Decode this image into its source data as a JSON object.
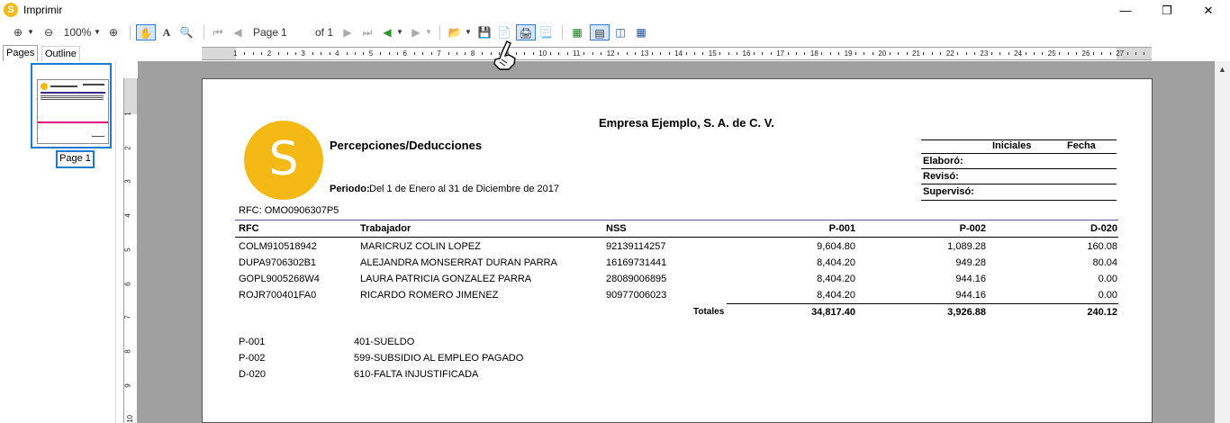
{
  "window": {
    "title": "Imprimir",
    "app_icon_letter": "S",
    "minimize_icon": "minimize-icon",
    "maximize_icon": "restore-icon",
    "close_icon": "close-icon"
  },
  "toolbar": {
    "zoom_value": "100%",
    "page_label": "Page",
    "page_value": "1",
    "of_label": "of 1"
  },
  "tabs": {
    "pages": "Pages",
    "outline": "Outline"
  },
  "ruler": {
    "h_numbers": [
      "1",
      "2",
      "3",
      "4",
      "5",
      "6",
      "7",
      "8",
      "9",
      "10",
      "11",
      "12",
      "13",
      "14",
      "15",
      "16",
      "17",
      "18",
      "19",
      "20",
      "21",
      "22",
      "23",
      "24",
      "25",
      "26",
      "27"
    ],
    "v_numbers": [
      "1",
      "2",
      "3",
      "4",
      "5",
      "6",
      "7",
      "8",
      "9",
      "10"
    ]
  },
  "thumbnail": {
    "label": "Page 1"
  },
  "report": {
    "logo_letter": "S",
    "company": "Empresa Ejemplo, S. A. de C. V.",
    "title": "Percepciones/Deducciones",
    "period_label": "Periodo:",
    "period_value": "Del 1 de Enero al 31 de Diciembre de 2017",
    "rfc_line": "RFC: OMO0906307P5",
    "sign_box": {
      "col1": "Iniciales",
      "col2": "Fecha",
      "rows": [
        "Elaboró:",
        "Revisó:",
        "Supervisó:"
      ]
    },
    "columns": [
      "RFC",
      "Trabajador",
      "NSS",
      "P-001",
      "P-002",
      "D-020"
    ],
    "rows": [
      [
        "COLM910518942",
        "MARICRUZ COLIN  LOPEZ",
        "92139114257",
        "9,604.80",
        "1,089.28",
        "160.08"
      ],
      [
        "DUPA9706302B1",
        "ALEJANDRA MONSERRAT DURAN PARRA",
        "16169731441",
        "8,404.20",
        "949.28",
        "80.04"
      ],
      [
        "GOPL9005268W4",
        "LAURA PATRICIA  GONZALEZ PARRA",
        "28089006895",
        "8,404.20",
        "944.16",
        "0.00"
      ],
      [
        "ROJR700401FA0",
        "RICARDO ROMERO JIMENEZ",
        "90977006023",
        "8,404.20",
        "944.16",
        "0.00"
      ]
    ],
    "totals_label": "Totales",
    "totals": [
      "34,817.40",
      "3,926.88",
      "240.12"
    ],
    "legend": [
      [
        "P-001",
        "401-SUELDO"
      ],
      [
        "P-002",
        "599-SUBSIDIO AL EMPLEO PAGADO"
      ],
      [
        "D-020",
        "610-FALTA INJUSTIFICADA"
      ]
    ]
  }
}
